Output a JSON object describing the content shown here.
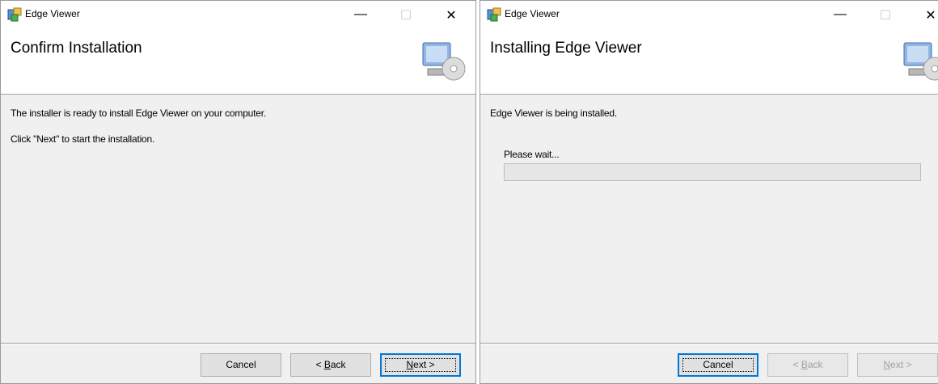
{
  "windows": {
    "left": {
      "title": "Edge Viewer",
      "heading": "Confirm Installation",
      "line1": "The installer is ready to install Edge Viewer on your computer.",
      "line2": "Click \"Next\" to start the installation.",
      "buttons": {
        "cancel": "Cancel",
        "back_prefix": "< ",
        "back_mn": "B",
        "back_rest": "ack",
        "next_mn": "N",
        "next_rest": "ext >"
      }
    },
    "right": {
      "title": "Edge Viewer",
      "heading": "Installing Edge Viewer",
      "line1": "Edge Viewer is being installed.",
      "wait_label": "Please wait...",
      "progress_value": 0,
      "buttons": {
        "cancel": "Cancel",
        "back_prefix": "< ",
        "back_mn": "B",
        "back_rest": "ack",
        "next_mn": "N",
        "next_rest": "ext >"
      }
    }
  },
  "controls": {
    "minimize_glyph": "—",
    "maximize_glyph": "☐",
    "close_glyph": "✕"
  },
  "icons": {
    "app": "installer-app-icon",
    "banner": "computer-cd-icon"
  },
  "colors": {
    "default_button_border": "#0078d7",
    "window_bg": "#f0f0f0",
    "progress_fill": "#06b025"
  }
}
